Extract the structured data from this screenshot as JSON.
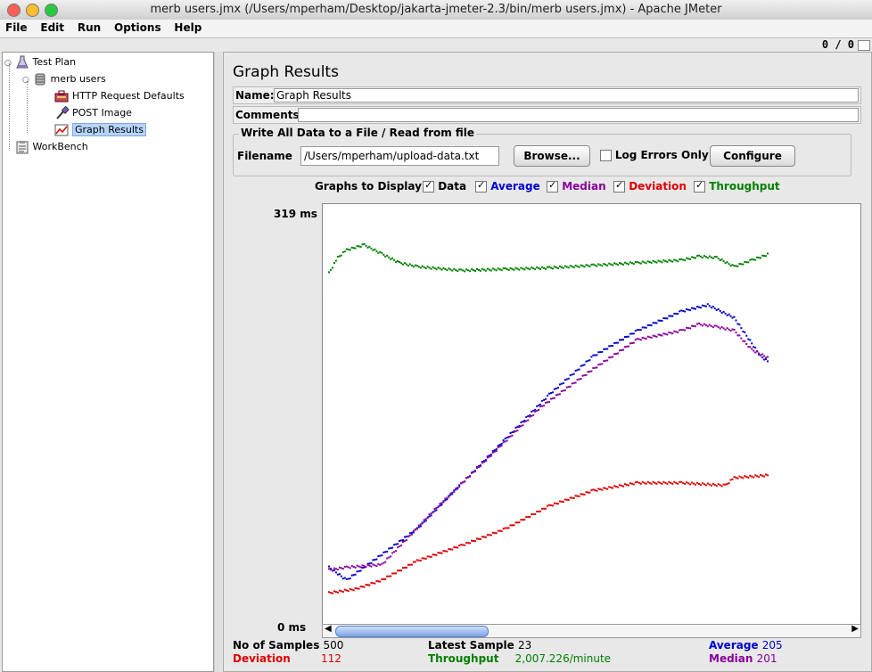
{
  "window": {
    "title": "merb users.jmx (/Users/mperham/Desktop/jakarta-jmeter-2.3/bin/merb users.jmx) - Apache JMeter"
  },
  "menu": [
    "File",
    "Edit",
    "Run",
    "Options",
    "Help"
  ],
  "thread_counter": "0 / 0",
  "tree": {
    "test_plan": "Test Plan",
    "thread_group": "merb users",
    "http_defaults": "HTTP Request Defaults",
    "post_image": "POST Image",
    "graph_results": "Graph Results",
    "workbench": "WorkBench"
  },
  "panel": {
    "heading": "Graph Results",
    "name_label": "Name:",
    "name_value": "Graph Results",
    "comments_label": "Comments:",
    "comments_value": "",
    "group_title": "Write All Data to a File / Read from file",
    "filename_label": "Filename",
    "filename_value": "/Users/mperham/upload-data.txt",
    "browse_label": "Browse...",
    "log_errors_label": "Log Errors Only",
    "configure_label": "Configure",
    "graphs_to_display": "Graphs to Display",
    "toggles": {
      "data": "Data",
      "average": "Average",
      "median": "Median",
      "deviation": "Deviation",
      "throughput": "Throughput"
    }
  },
  "colors": {
    "data": "#000000",
    "average": "#0000cc",
    "median": "#880099",
    "deviation": "#dd0000",
    "throughput": "#008000"
  },
  "chart_data": {
    "type": "scatter",
    "y_max_label": "319 ms",
    "y_min_label": "0 ms",
    "ylim": [
      0,
      319
    ],
    "xlim": [
      0,
      500
    ],
    "series": [
      {
        "name": "Average",
        "color": "#0000cc",
        "points": [
          [
            0,
            40
          ],
          [
            20,
            30
          ],
          [
            50,
            45
          ],
          [
            100,
            70
          ],
          [
            150,
            105
          ],
          [
            200,
            140
          ],
          [
            250,
            175
          ],
          [
            300,
            205
          ],
          [
            350,
            225
          ],
          [
            400,
            240
          ],
          [
            430,
            245
          ],
          [
            460,
            235
          ],
          [
            490,
            205
          ],
          [
            500,
            200
          ]
        ]
      },
      {
        "name": "Median",
        "color": "#880099",
        "points": [
          [
            0,
            38
          ],
          [
            20,
            40
          ],
          [
            60,
            42
          ],
          [
            120,
            85
          ],
          [
            180,
            125
          ],
          [
            240,
            165
          ],
          [
            300,
            195
          ],
          [
            350,
            218
          ],
          [
            380,
            222
          ],
          [
            400,
            225
          ],
          [
            420,
            230
          ],
          [
            440,
            228
          ],
          [
            460,
            225
          ],
          [
            480,
            210
          ],
          [
            500,
            203
          ]
        ]
      },
      {
        "name": "Deviation",
        "color": "#dd0000",
        "points": [
          [
            0,
            20
          ],
          [
            30,
            23
          ],
          [
            60,
            30
          ],
          [
            100,
            45
          ],
          [
            150,
            57
          ],
          [
            200,
            70
          ],
          [
            250,
            88
          ],
          [
            300,
            100
          ],
          [
            350,
            106
          ],
          [
            400,
            106
          ],
          [
            450,
            104
          ],
          [
            460,
            110
          ],
          [
            500,
            112
          ]
        ]
      },
      {
        "name": "Throughput",
        "color": "#008000",
        "points": [
          [
            0,
            270
          ],
          [
            10,
            282
          ],
          [
            20,
            288
          ],
          [
            40,
            292
          ],
          [
            60,
            285
          ],
          [
            80,
            278
          ],
          [
            100,
            275
          ],
          [
            150,
            272
          ],
          [
            200,
            273
          ],
          [
            250,
            274
          ],
          [
            300,
            276
          ],
          [
            350,
            278
          ],
          [
            400,
            280
          ],
          [
            420,
            283
          ],
          [
            440,
            282
          ],
          [
            460,
            275
          ],
          [
            480,
            280
          ],
          [
            500,
            285
          ]
        ]
      }
    ]
  },
  "stats": {
    "no_samples_label": "No of Samples",
    "no_samples_value": "500",
    "latest_sample_label": "Latest Sample",
    "latest_sample_value": "23",
    "average_label": "Average",
    "average_value": "205",
    "deviation_label": "Deviation",
    "deviation_value": "112",
    "throughput_label": "Throughput",
    "throughput_value": "2,007.226/minute",
    "median_label": "Median",
    "median_value": "201"
  }
}
